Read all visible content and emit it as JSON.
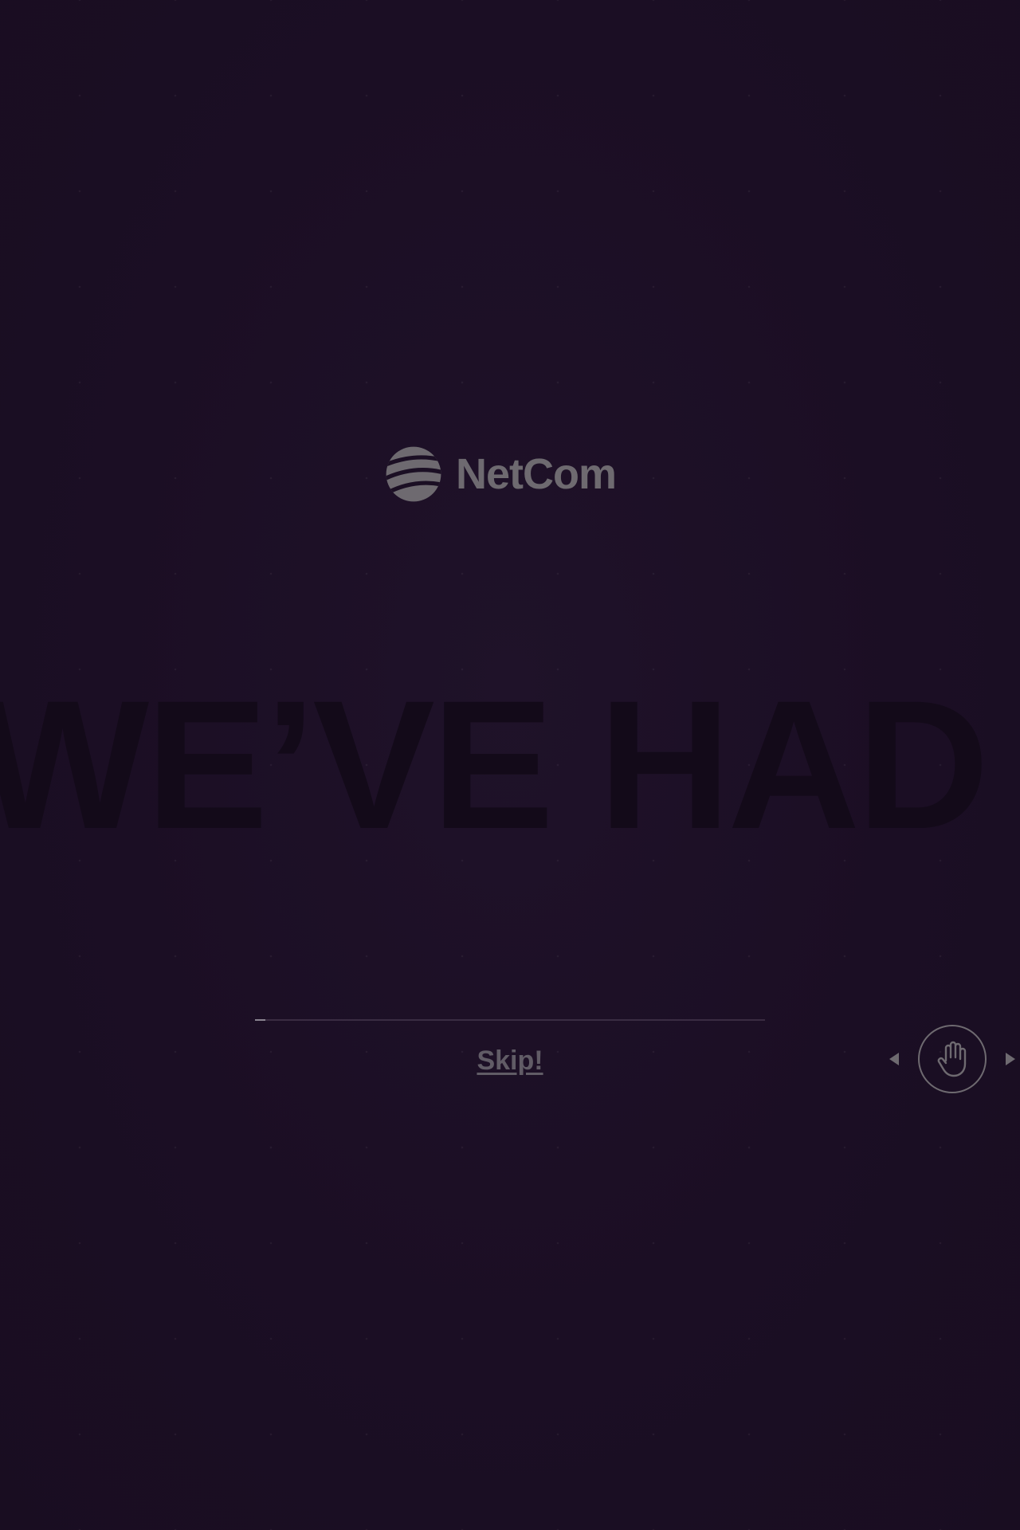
{
  "brand": {
    "name": "NetCom",
    "logo_icon": "netcom-globe-icon"
  },
  "intro": {
    "headline": "WE’VE HAD"
  },
  "loader": {
    "progress": 0.02
  },
  "skip": {
    "label": "Skip!"
  },
  "swipe_hint": {
    "icon": "hand-icon",
    "left_icon": "arrow-left-icon",
    "right_icon": "arrow-right-icon"
  },
  "colors": {
    "background": "#1b0f24",
    "logo": "#6e6a70",
    "headline": "#130a19",
    "progress_track": "#3a2c42",
    "progress_fill": "#8a8490",
    "skip_text": "#615c66"
  }
}
